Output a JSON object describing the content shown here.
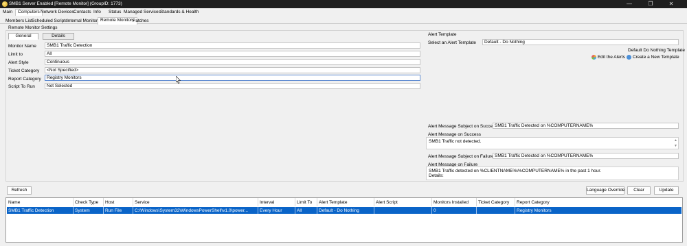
{
  "window": {
    "title": "SMB1 Server Enabled [Remote Monitor]  (GroupID: 1773)",
    "minimize": "—",
    "maximize": "❐",
    "close": "✕"
  },
  "menu": [
    "Main",
    "Computers",
    "Network Devices",
    "Contacts",
    "Info",
    "Status",
    "Managed Services",
    "Standards & Health"
  ],
  "subtabs": [
    "Members List",
    "Scheduled Scripts",
    "Internal Monitors",
    "Remote Monitors",
    "Patches"
  ],
  "settings": {
    "group_label": "Remote Monitor Settings",
    "tab_general": "General",
    "tab_details": "Details",
    "monitor_name_label": "Monitor Name",
    "monitor_name_value": "SMB1 Traffic Detection",
    "limit_to_label": "Limit to",
    "limit_to_value": "All",
    "alert_style_label": "Alert Style",
    "alert_style_value": "Continuous",
    "ticket_category_label": "Ticket Category",
    "ticket_category_value": "<Not Specified>",
    "report_category_label": "Report Category",
    "report_category_value": "Registry Monitors",
    "script_to_run_label": "Script To Run",
    "script_to_run_value": "Not Selected"
  },
  "alert_template": {
    "label": "Alert Template",
    "select_label": "Select an Alert Template",
    "select_value": "Default - Do Nothing",
    "default_note": "Default Do Nothing Template",
    "edit_alerts": "Edit the Alerts",
    "create_template": "Create a New Template"
  },
  "messages": {
    "success_subject_label": "Alert Message Subject on Success:",
    "success_subject_value": "SMB1 Traffic Detected on %COMPUTERNAME%",
    "success_message_label": "Alert Message on Success",
    "success_message_value": "SMB1 Traffic not detected.",
    "failure_subject_label": "Alert Message Subject on Failure:",
    "failure_subject_value": "SMB1 Traffic Detected on %COMPUTERNAME%",
    "failure_message_label": "Alert Message on Failure",
    "failure_message_line1": "SMB1 Traffic detected on %CLIENTNAME%\\%COMPUTERNAME% in the past 1 hour.",
    "failure_message_line2": "Details:"
  },
  "buttons": {
    "refresh": "Refresh",
    "language_override": "Language Override",
    "clear": "Clear",
    "update": "Update"
  },
  "table": {
    "headers": [
      "Name",
      "Check Type",
      "Host",
      "Service",
      "Interval",
      "Limit To",
      "Alert Template",
      "Alert Script",
      "Monitors Installed",
      "Ticket Category",
      "Report Category"
    ],
    "rows": [
      [
        "SMB1 Traffic Detection",
        "System",
        "Run File",
        "C:\\Windows\\System32\\WindowsPowerShell\\v1.0\\power...",
        "Every Hour",
        "All",
        "Default - Do Nothing",
        "",
        "0",
        "",
        "Registry Monitors"
      ]
    ]
  },
  "colors": {
    "selection": "#0a64c8",
    "titlebar": "#1f1f1f",
    "accent_focus": "#5f8bd1"
  }
}
